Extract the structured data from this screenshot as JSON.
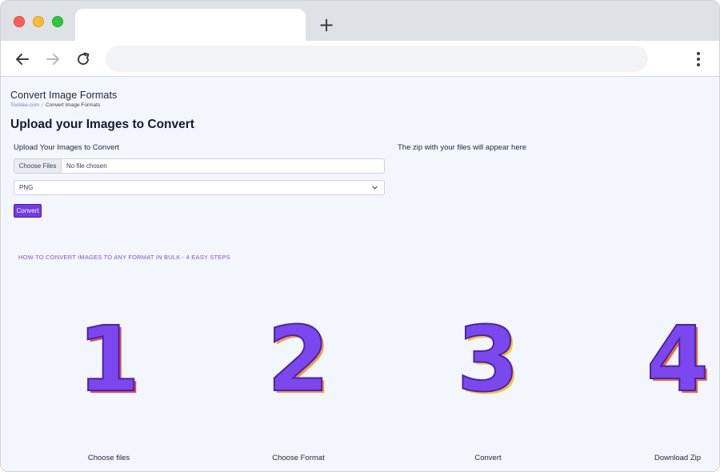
{
  "browser": {
    "new_tab_symbol": "+",
    "icons": [
      "back-arrow-icon",
      "forward-arrow-icon",
      "reload-icon",
      "menu-dots-icon",
      "new-tab-icon"
    ]
  },
  "page": {
    "site_title": "Convert Image Formats",
    "breadcrumb": {
      "home": "Toolske.com",
      "separator": "/",
      "current": "Convert Image Formats"
    },
    "heading": "Upload your Images to Convert",
    "upload_label": "Upload Your Images to Convert",
    "zip_note": "The zip with your files will appear here",
    "file_input": {
      "button_label": "Choose Files",
      "status": "No file chosen"
    },
    "format_select": {
      "value": "PNG"
    },
    "convert_label": "Convert",
    "howto_title": "HOW TO CONVERT IMAGES TO ANY FORMAT IN BULK - 4 EASY STEPS",
    "steps": [
      {
        "number": "1",
        "label": "Choose files",
        "fill": "#7b47ee",
        "shadow": "#e24a4a"
      },
      {
        "number": "2",
        "label": "Choose Format",
        "fill": "#7b47ee",
        "shadow": "#f29a3c"
      },
      {
        "number": "3",
        "label": "Convert",
        "fill": "#7b47ee",
        "shadow": "#f5c12e"
      },
      {
        "number": "4",
        "label": "Download Zip",
        "fill": "#7b47ee",
        "shadow": "#ef6a2e"
      }
    ]
  },
  "colors": {
    "accent": "#7239e9",
    "page_bg": "#f3f6fc",
    "howto": "#7f52d6"
  }
}
